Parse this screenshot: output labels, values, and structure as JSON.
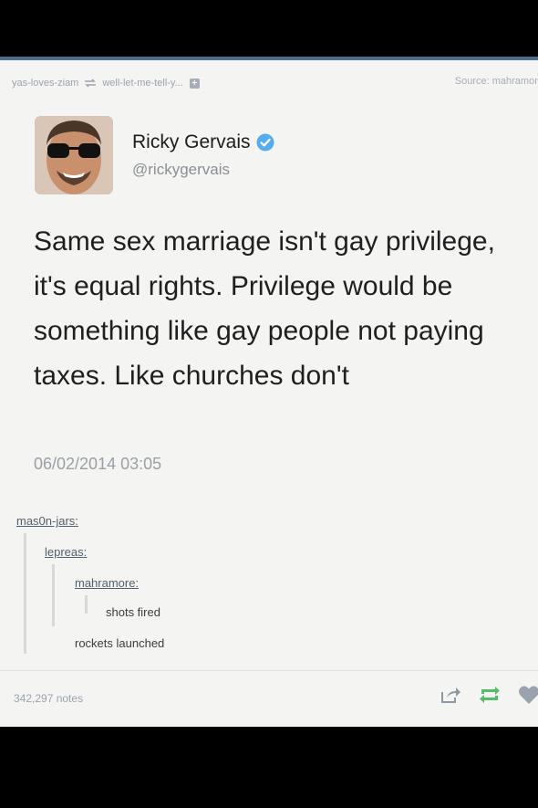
{
  "reblog": {
    "from_user": "yas-loves-ziam",
    "to_user": "well-let-me-tell-y...",
    "source_label": "Source: mahramore"
  },
  "tweet": {
    "author_name": "Ricky Gervais",
    "author_handle": "@rickygervais",
    "text": "Same sex marriage isn't gay privilege, it's equal rights. Privilege would be something like gay people not paying taxes. Like churches don't",
    "timestamp": "06/02/2014 03:05",
    "verified_color": "#55acee"
  },
  "thread": [
    {
      "user": "mas0n-jars",
      "colon": ":"
    },
    {
      "user": "lepreas",
      "colon": ":"
    },
    {
      "user": "mahramore",
      "colon": ":"
    },
    {
      "message": "shots fired"
    },
    {
      "message": "rockets launched"
    }
  ],
  "footer": {
    "notes": "342,297 notes"
  },
  "colors": {
    "header_bar": "#4d6e8d",
    "post_bg": "#f4f4f2"
  }
}
